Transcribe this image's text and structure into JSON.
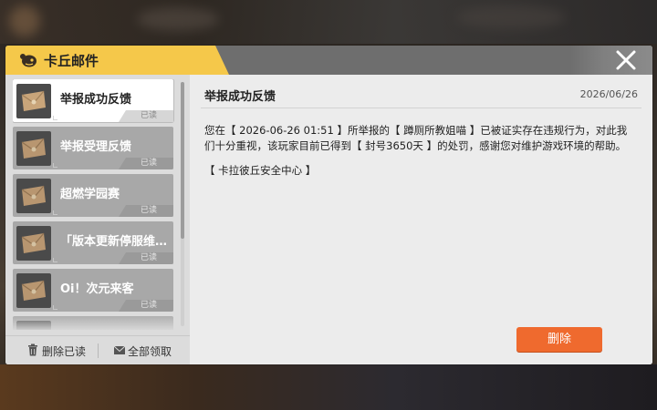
{
  "dialog": {
    "title": "卡丘邮件",
    "icons": {
      "title": "mail-mascot-icon",
      "close": "close-icon"
    }
  },
  "mail_list": [
    {
      "title": "举报成功反馈",
      "status": "已读",
      "selected": true
    },
    {
      "title": "举报受理反馈",
      "status": "已读",
      "selected": false
    },
    {
      "title": "超燃学园赛",
      "status": "已读",
      "selected": false
    },
    {
      "title": "「版本更新停服维护…",
      "status": "已读",
      "selected": false
    },
    {
      "title": "Oi！次元来客",
      "status": "已读",
      "selected": false
    }
  ],
  "footer": {
    "delete_read": "删除已读",
    "claim_all": "全部领取",
    "icons": {
      "delete_read": "trash-icon",
      "claim_all": "envelope-icon"
    }
  },
  "mail": {
    "title": "举报成功反馈",
    "date": "2026/06/26",
    "body": "您在【 2026-06-26 01:51 】所举报的【 蹲厕所教姐喵 】已被证实存在违规行为，对此我们十分重视，该玩家目前已得到【 封号3650天 】的处罚，感谢您对维护游戏环境的帮助。",
    "signature": "【 卡拉彼丘安全中心 】",
    "delete_button": "删除"
  },
  "colors": {
    "accent": "#f5c84a",
    "delete": "#ef6a2e",
    "titlebar": "#6e6e6e",
    "item_unselected": "#a8a8a8"
  }
}
